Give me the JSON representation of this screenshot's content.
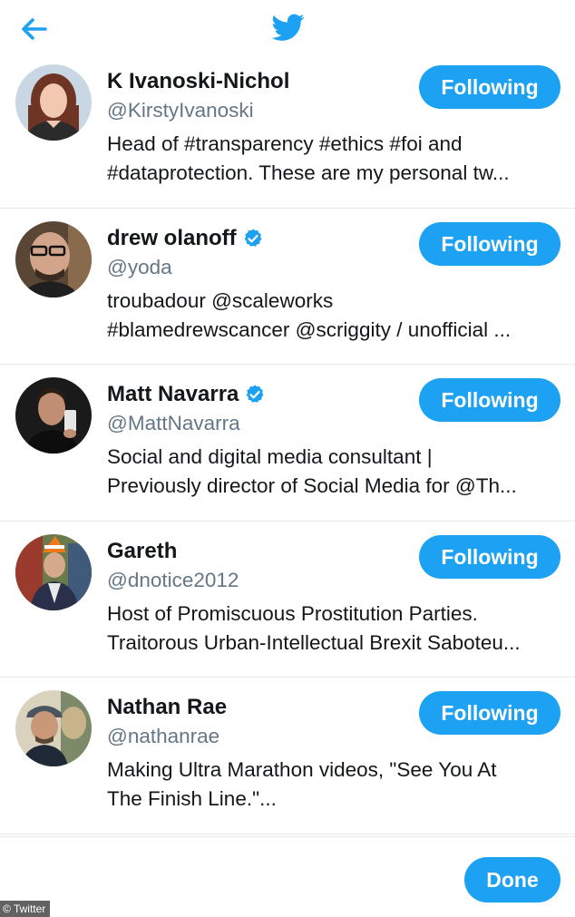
{
  "colors": {
    "accent": "#1da1f2",
    "text": "#14171a",
    "secondary": "#657786",
    "divider": "#e6ecf0"
  },
  "header": {
    "back_icon": "arrow-left-icon",
    "logo_icon": "twitter-bird-icon"
  },
  "users": [
    {
      "name": "K Ivanoski-Nichol",
      "verified": false,
      "handle": "@KirstyIvanoski",
      "bio_line1": "Head of #transparency #ethics #foi and",
      "bio_line2": "#dataprotection. These are my personal tw...",
      "button": "Following"
    },
    {
      "name": "drew olanoff",
      "verified": true,
      "handle": "@yoda",
      "bio_line1": "troubadour @scaleworks",
      "bio_line2": "#blamedrewscancer @scriggity / unofficial ...",
      "button": "Following"
    },
    {
      "name": "Matt Navarra",
      "verified": true,
      "handle": "@MattNavarra",
      "bio_line1": "Social and digital media consultant |",
      "bio_line2": "Previously director of Social Media for @Th...",
      "button": "Following"
    },
    {
      "name": "Gareth",
      "verified": false,
      "handle": "@dnotice2012",
      "bio_line1": "Host of Promiscuous Prostitution Parties.",
      "bio_line2": "Traitorous Urban-Intellectual Brexit Saboteu...",
      "button": "Following"
    },
    {
      "name": "Nathan Rae",
      "verified": false,
      "handle": "@nathanrae",
      "bio_line1": "Making Ultra Marathon videos, \"See You At",
      "bio_line2": "The Finish Line.\"...",
      "button": "Following"
    }
  ],
  "footer": {
    "done_label": "Done"
  },
  "credit": "© Twitter"
}
